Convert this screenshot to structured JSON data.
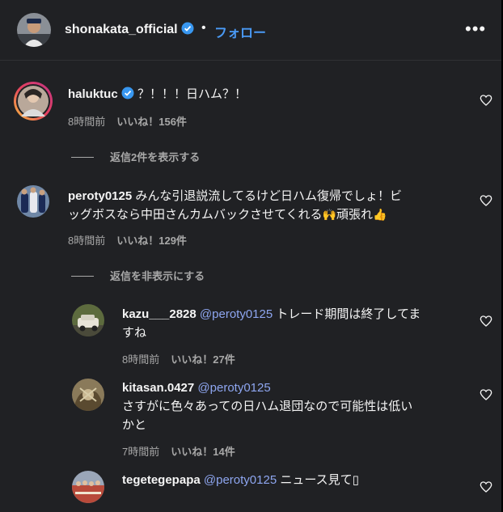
{
  "header": {
    "username": "shonakata_official",
    "dot": "•",
    "follow_label": "フォロー",
    "more_label": "•••"
  },
  "comments": [
    {
      "username": "haluktuc",
      "text": "？！！！日ハム？！",
      "time": "8時間前",
      "likes": "いいね！156件",
      "replies_toggle": "返信2件を表示する"
    },
    {
      "username": "peroty0125",
      "text_line1": "みんな引退説流してるけど日ハム復帰でしょ！ビ",
      "text_line2": "ッグボスなら中田さんカムバックさせてくれる",
      "emoji1": "🙌",
      "text_line2b": "頑張れ",
      "emoji2": "👍",
      "time": "8時間前",
      "likes": "いいね！129件",
      "replies_toggle": "返信を非表示にする"
    }
  ],
  "replies": [
    {
      "username": "kazu___2828",
      "mention": "@peroty0125",
      "text_line1": "トレード期間は終了してま",
      "text_line2": "すね",
      "time": "8時間前",
      "likes": "いいね！27件"
    },
    {
      "username": "kitasan.0427",
      "mention": "@peroty0125",
      "text_line1": "さすがに色々あっての日ハム退団なので可能性は低い",
      "text_line2": "かと",
      "time": "7時間前",
      "likes": "いいね！14件"
    },
    {
      "username": "tegetegepapa",
      "mention": "@peroty0125",
      "text_line1": "ニュース見て▯"
    }
  ]
}
